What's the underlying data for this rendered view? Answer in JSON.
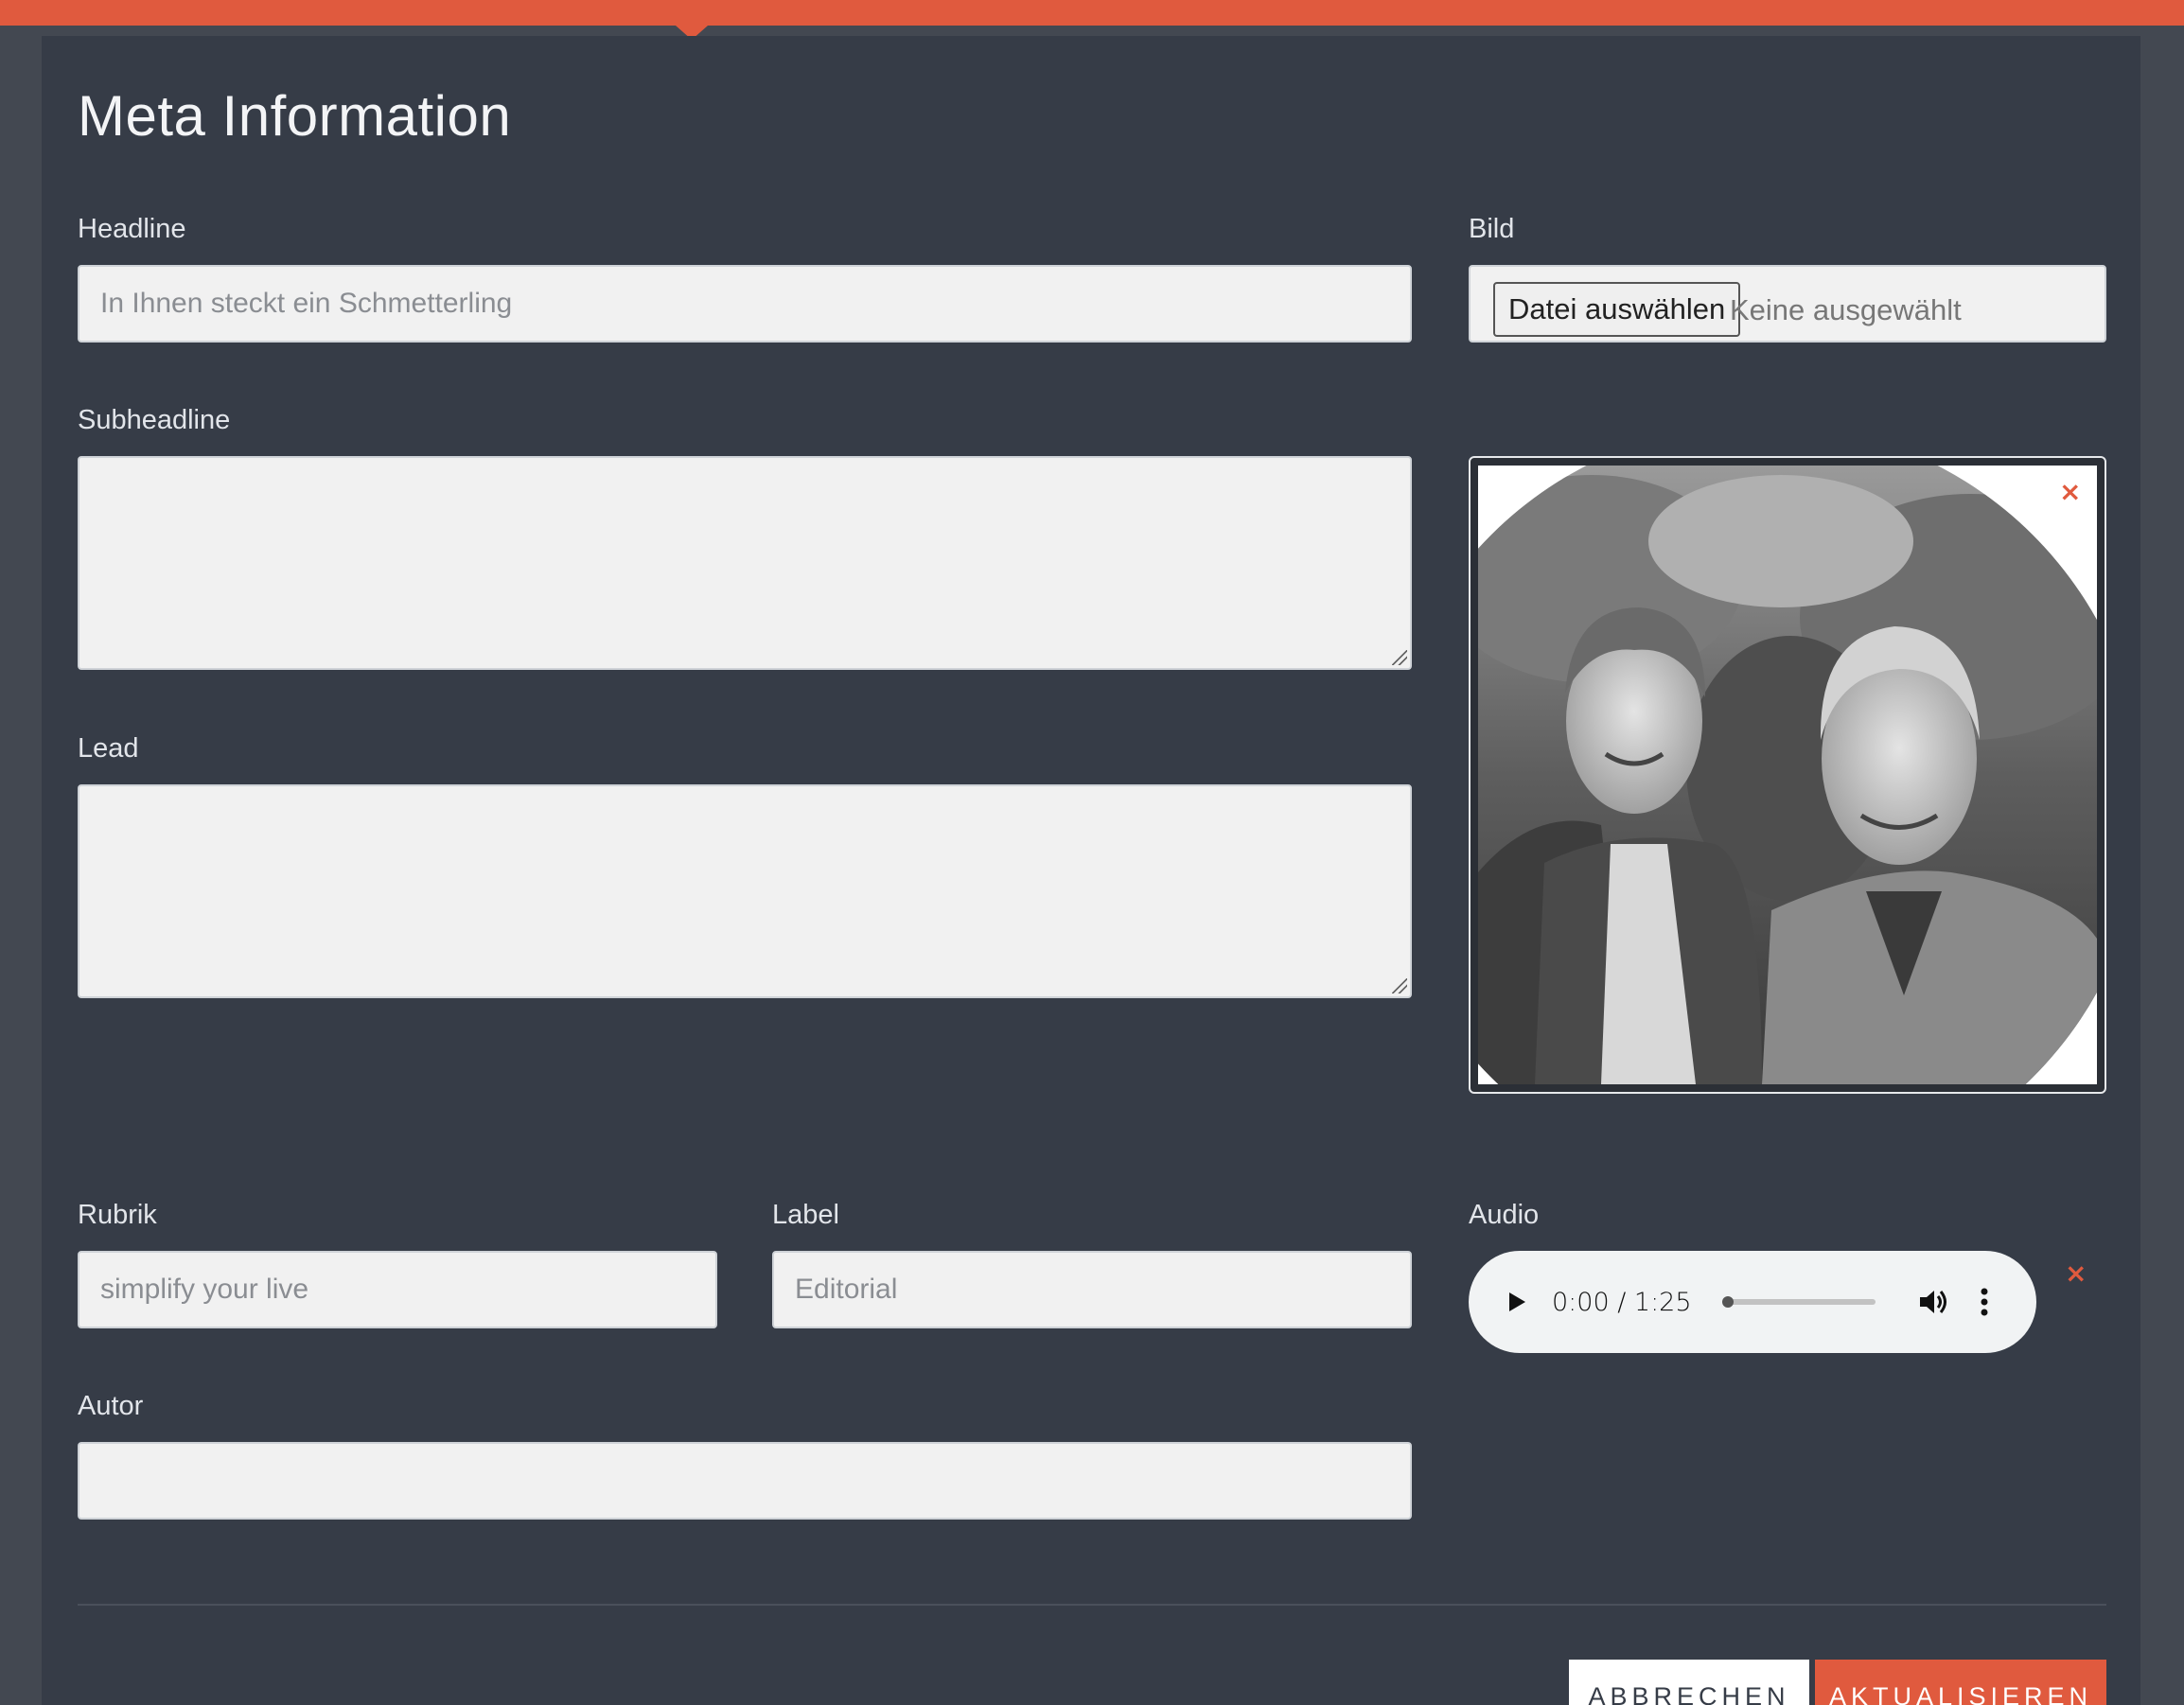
{
  "page": {
    "title": "Meta Information"
  },
  "fields": {
    "headline": {
      "label": "Headline",
      "value": "In Ihnen steckt ein Schmetterling"
    },
    "bild": {
      "label": "Bild",
      "button_label": "Datei auswählen",
      "status": "Keine ausgewählt"
    },
    "subheadline": {
      "label": "Subheadline",
      "value": ""
    },
    "lead": {
      "label": "Lead",
      "value": ""
    },
    "rubrik": {
      "label": "Rubrik",
      "value": "simplify your live"
    },
    "label_field": {
      "label": "Label",
      "value": "Editorial"
    },
    "audio": {
      "label": "Audio",
      "time": "0:00 / 1:25",
      "progress": 0.0
    },
    "autor": {
      "label": "Autor",
      "value": ""
    }
  },
  "icons": {
    "remove": "×",
    "play": "play-icon",
    "volume": "volume-icon",
    "more": "more-vert-icon"
  },
  "actions": {
    "cancel_label": "ABBRECHEN",
    "update_label": "AKTUALISIEREN"
  },
  "colors": {
    "accent": "#e05a3e",
    "panel": "#363c47",
    "background": "#434851",
    "input": "#f1f1f1"
  }
}
